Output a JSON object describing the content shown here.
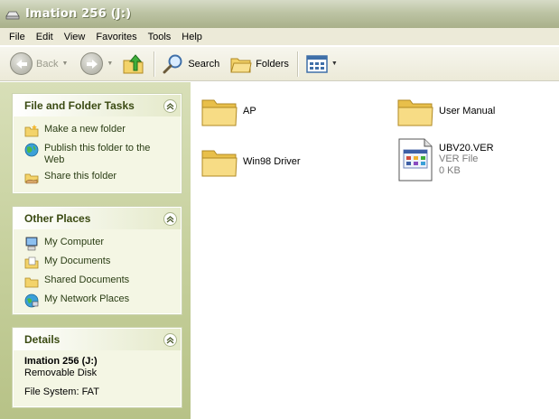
{
  "window": {
    "title": "Imation 256 (J:)"
  },
  "menu": [
    {
      "label": "File",
      "name": "menu-file"
    },
    {
      "label": "Edit",
      "name": "menu-edit"
    },
    {
      "label": "View",
      "name": "menu-view"
    },
    {
      "label": "Favorites",
      "name": "menu-favorites"
    },
    {
      "label": "Tools",
      "name": "menu-tools"
    },
    {
      "label": "Help",
      "name": "menu-help"
    }
  ],
  "toolbar": {
    "back_label": "Back",
    "search_label": "Search",
    "folders_label": "Folders"
  },
  "tasks_panel": {
    "title": "File and Folder Tasks",
    "items": [
      {
        "label": "Make a new folder",
        "icon": "new-folder-icon"
      },
      {
        "label": "Publish this folder to the Web",
        "icon": "globe-publish-icon"
      },
      {
        "label": "Share this folder",
        "icon": "share-folder-icon"
      }
    ]
  },
  "places_panel": {
    "title": "Other Places",
    "items": [
      {
        "label": "My Computer",
        "icon": "my-computer-icon"
      },
      {
        "label": "My Documents",
        "icon": "my-documents-icon"
      },
      {
        "label": "Shared Documents",
        "icon": "shared-documents-icon"
      },
      {
        "label": "My Network Places",
        "icon": "network-places-icon"
      }
    ]
  },
  "details_panel": {
    "title": "Details",
    "name": "Imation 256 (J:)",
    "type": "Removable Disk",
    "filesystem": "File System: FAT"
  },
  "files": [
    {
      "name": "AP",
      "kind": "folder"
    },
    {
      "name": "User Manual",
      "kind": "folder"
    },
    {
      "name": "Win98 Driver",
      "kind": "folder"
    },
    {
      "name": "UBV20.VER",
      "kind": "file",
      "type": "VER File",
      "size": "0 KB"
    }
  ],
  "colors": {
    "folder": "#f3d36a",
    "link": "#2a3d14",
    "panel_title": "#3a4a12",
    "title_bar": "#b7bd9c"
  }
}
